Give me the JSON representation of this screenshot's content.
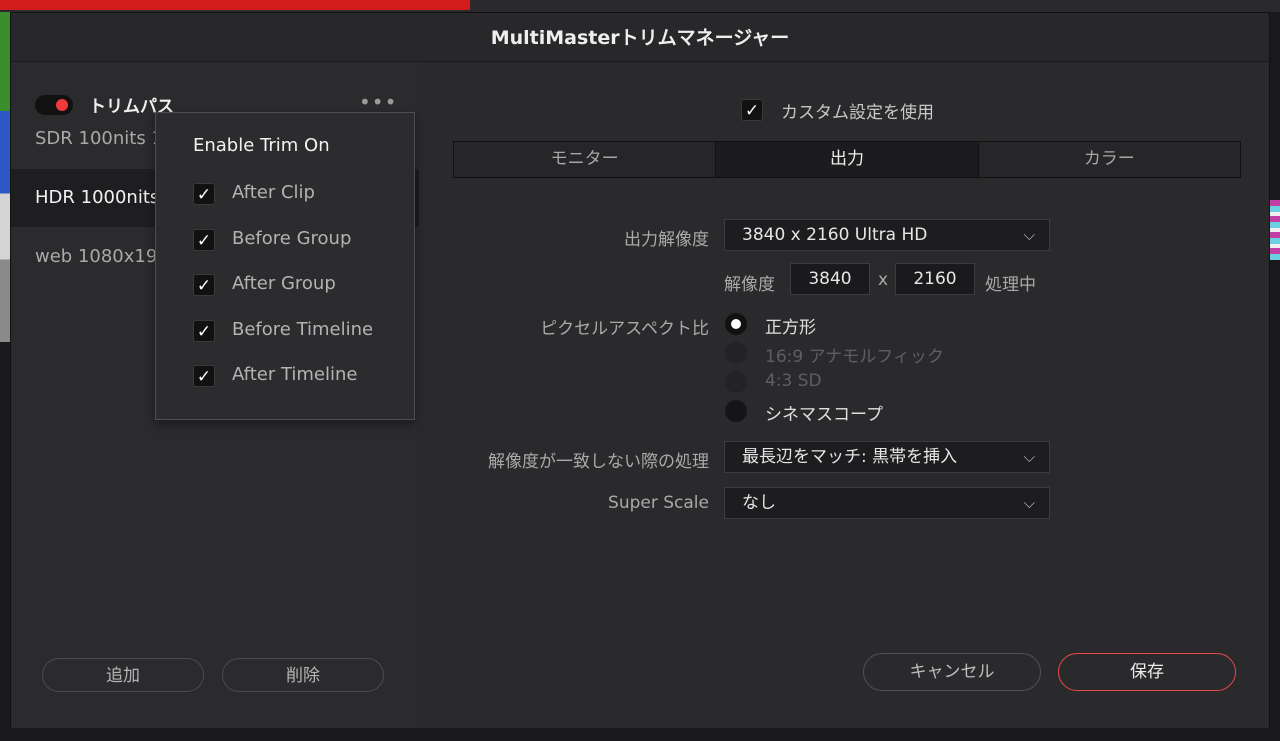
{
  "dialog": {
    "title": "MultiMasterトリムマネージャー"
  },
  "left": {
    "pass_label": "トリムパス",
    "trims": [
      {
        "label": "SDR 100nits 1",
        "selected": false
      },
      {
        "label": "HDR 1000nits",
        "selected": true
      },
      {
        "label": "web 1080x19",
        "selected": false
      }
    ],
    "add_label": "追加",
    "delete_label": "削除"
  },
  "popup": {
    "title": "Enable Trim On",
    "items": [
      {
        "label": "After Clip",
        "checked": true
      },
      {
        "label": "Before Group",
        "checked": true
      },
      {
        "label": "After Group",
        "checked": true
      },
      {
        "label": "Before Timeline",
        "checked": true
      },
      {
        "label": "After Timeline",
        "checked": true
      }
    ]
  },
  "right": {
    "custom_label": "カスタム設定を使用",
    "custom_checked": true,
    "tabs": [
      {
        "label": "モニター",
        "active": false
      },
      {
        "label": "出力",
        "active": true
      },
      {
        "label": "カラー",
        "active": false
      }
    ],
    "output_resolution_label": "出力解像度",
    "output_resolution_value": "3840 x 2160 Ultra HD",
    "resolution_label": "解像度",
    "width": "3840",
    "x_sep": "x",
    "height": "2160",
    "processing_label": "処理中",
    "pixel_aspect_label": "ピクセルアスペクト比",
    "aspect_options": [
      {
        "label": "正方形",
        "selected": true,
        "disabled": false
      },
      {
        "label": "16:9 アナモルフィック",
        "selected": false,
        "disabled": true
      },
      {
        "label": "4:3 SD",
        "selected": false,
        "disabled": true
      },
      {
        "label": "シネマスコープ",
        "selected": false,
        "disabled": false
      }
    ],
    "mismatch_label": "解像度が一致しない際の処理",
    "mismatch_value": "最長辺をマッチ: 黒帯を挿入",
    "superscale_label": "Super Scale",
    "superscale_value": "なし",
    "cancel_label": "キャンセル",
    "save_label": "保存"
  },
  "colors": {
    "accent": "#e44a4a",
    "toggle_on": "#f03a3a"
  }
}
